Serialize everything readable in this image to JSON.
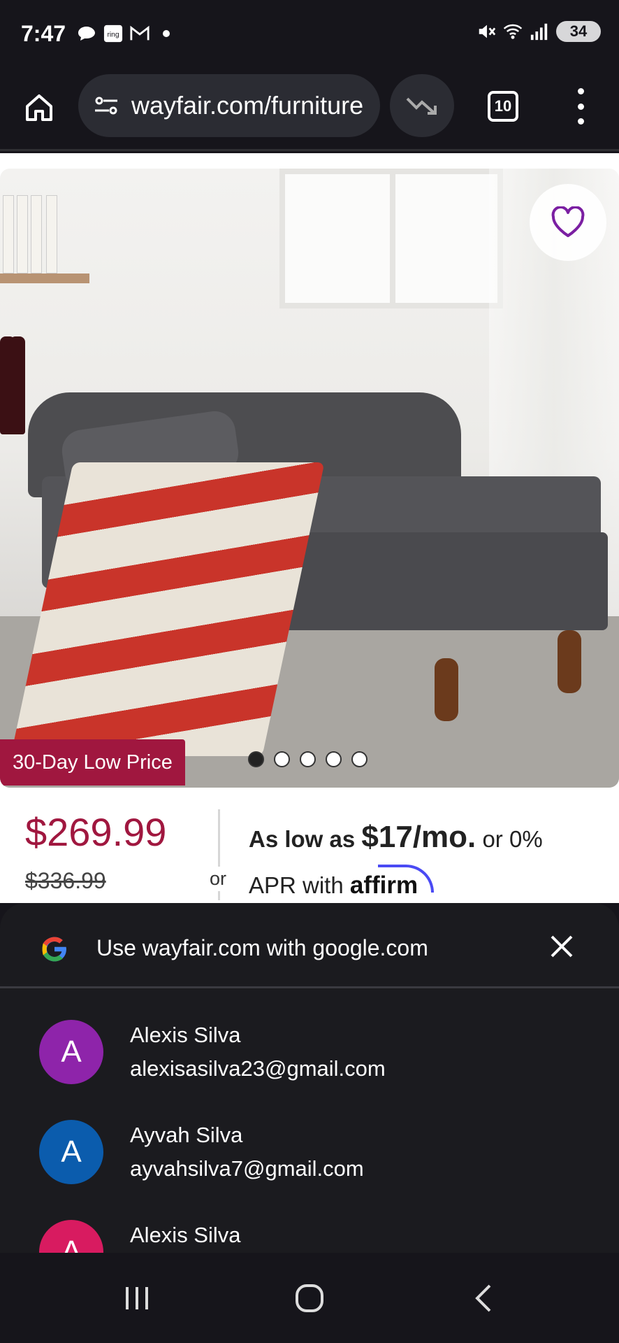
{
  "status_bar": {
    "time": "7:47",
    "battery": "34",
    "left_icons": [
      "chat-bubble-icon",
      "ring-icon",
      "gmail-icon",
      "dot-icon"
    ],
    "right_icons": [
      "mute-icon",
      "wifi-icon",
      "signal-icon",
      "battery-icon"
    ]
  },
  "browser": {
    "url": "wayfair.com/furniture",
    "tab_count": "10"
  },
  "product": {
    "badge": "30-Day Low Price",
    "price": "$269.99",
    "was_price": "$336.99",
    "or": "or",
    "financing_prefix": "As low as",
    "financing_amount": "$17/mo.",
    "financing_suffix": "or 0%",
    "financing_line2": "APR with",
    "affirm": "affirm",
    "carousel_total": 5,
    "carousel_active": 1
  },
  "sign_in_sheet": {
    "title": "Use wayfair.com with google.com",
    "accounts": [
      {
        "initial": "A",
        "name": "Alexis Silva",
        "email": "alexisasilva23@gmail.com",
        "color": "#8e24aa"
      },
      {
        "initial": "A",
        "name": "Ayvah Silva",
        "email": "ayvahsilva7@gmail.com",
        "color": "#0b5cad"
      },
      {
        "initial": "A",
        "name": "Alexis Silva",
        "email": "",
        "color": "#d81b60"
      }
    ]
  },
  "colors": {
    "accent": "#a0173f",
    "heart": "#7b1fa2",
    "background_dark": "#16151b"
  }
}
